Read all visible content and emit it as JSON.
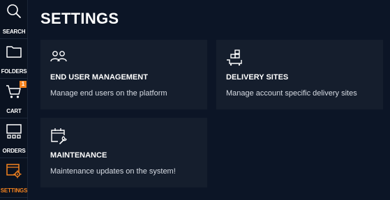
{
  "sidebar": {
    "items": [
      {
        "label": "SEARCH",
        "icon": "search-icon"
      },
      {
        "label": "FOLDERS",
        "icon": "folder-icon"
      },
      {
        "label": "CART",
        "icon": "cart-icon",
        "badge": "1"
      },
      {
        "label": "ORDERS",
        "icon": "orders-icon"
      },
      {
        "label": "SETTINGS",
        "icon": "settings-icon",
        "active": true
      }
    ]
  },
  "page": {
    "title": "SETTINGS"
  },
  "cards": [
    {
      "title": "END USER MANAGEMENT",
      "description": "Manage end users on the platform",
      "icon": "users-icon"
    },
    {
      "title": "DELIVERY SITES",
      "description": "Manage account specific delivery sites",
      "icon": "delivery-sites-icon"
    },
    {
      "title": "MAINTENANCE",
      "description": "Maintenance updates on the system!",
      "icon": "maintenance-icon"
    }
  ],
  "colors": {
    "background": "#0c1526",
    "card": "#151e2d",
    "accent": "#f5831f"
  }
}
